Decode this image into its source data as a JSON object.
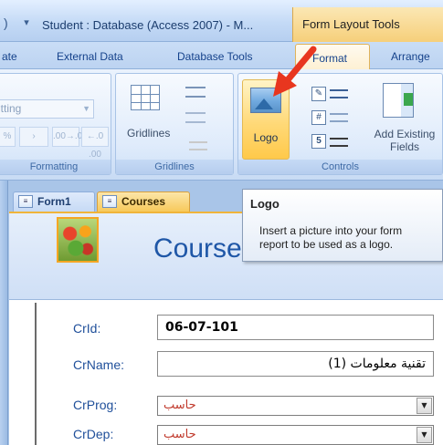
{
  "titlebar": {
    "quick_access_glyph": "▾",
    "title": "Student : Database (Access 2007) - M...",
    "context_group_label": "Form Layout Tools"
  },
  "ribbon_tabs": [
    {
      "label": "ate"
    },
    {
      "label": "External Data"
    },
    {
      "label": "Database Tools"
    },
    {
      "label": "Format",
      "active": true
    },
    {
      "label": "Arrange"
    }
  ],
  "ribbon": {
    "formatting": {
      "select_value": "itting",
      "mini_buttons": [
        "%",
        "›",
        ".00→.0",
        "←.0 .00"
      ],
      "group_label": "Formatting"
    },
    "gridlines": {
      "button_label": "Gridlines",
      "group_label": "Gridlines"
    },
    "controls": {
      "logo_label": "Logo",
      "add_existing_fields_label": "Add Existing\nFields",
      "group_label": "Controls"
    }
  },
  "tooltip": {
    "title": "Logo",
    "line1": "Insert a picture into your form",
    "line2": "report to be used as a logo."
  },
  "document_tabs": [
    {
      "label": "Form1",
      "active": false
    },
    {
      "label": "Courses",
      "active": true
    }
  ],
  "form": {
    "title": "Courses",
    "fields": [
      {
        "label": "CrId:",
        "value": "06-07-101"
      },
      {
        "label": "CrName:",
        "value": "تقنية معلومات (1)"
      },
      {
        "label": "CrProg:",
        "value": "حاسب"
      },
      {
        "label": "CrDep:",
        "value": "حاسب"
      }
    ]
  },
  "colors": {
    "accent_orange": "#f5a623",
    "arrow_red": "#e8361f",
    "label_blue": "#1f4f9a"
  }
}
